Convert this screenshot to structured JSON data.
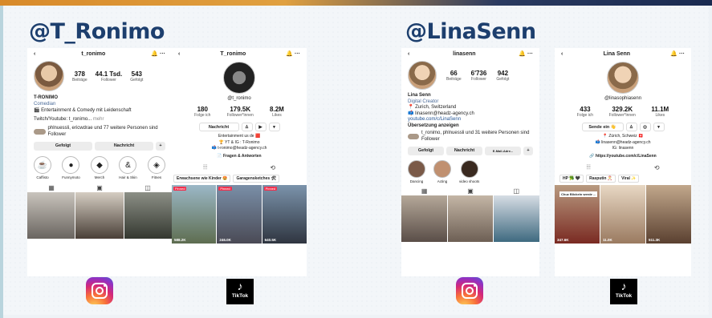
{
  "handles": {
    "left": "@T_Ronimo",
    "right": "@LinaSenn"
  },
  "ronimo_ig": {
    "username": "t_ronimo",
    "posts": "378",
    "posts_label": "Beiträge",
    "followers": "44.1 Tsd.",
    "followers_label": "Follower",
    "following": "543",
    "following_label": "Gefolgt",
    "name": "T-RONIMO",
    "category": "Comedian",
    "bio": "🎬 Entertainment & Comedy mit Leidenschaft",
    "bio2": "Twitch/Youtube: t_ronimo...",
    "more": "mehr",
    "followed_by": "phlnuessli, ericwdrae und 77 weitere Personen sind Follower",
    "btn_follow": "Gefolgt",
    "btn_message": "Nachricht",
    "highlights": [
      "Caffisto",
      "Funnymoto",
      "Merch",
      "Hair & Skin",
      "Fitnes"
    ]
  },
  "ronimo_tt": {
    "username": "T_ronimo",
    "handle": "@t_ronimo",
    "following": "180",
    "following_label": "Folge ich",
    "followers": "179.5K",
    "followers_label": "Follower*innen",
    "likes": "8.2M",
    "likes_label": "Likes",
    "btn_message": "Nachricht",
    "bio1": "Entertainment us de 🟥",
    "bio2": "🏆 YT & IG : T-Ronimo",
    "bio3": "📫 t-ronimo@headz-agency.ch",
    "qa": "📄 Fragen & Antworten",
    "playlist1": "Erwachsene wie Kinder 🤩",
    "playlist2": "Garagensketches 🛠",
    "pinned": "Pinned",
    "views": [
      "588.2K",
      "246.0K",
      "640.5K"
    ]
  },
  "lina_ig": {
    "username": "linasenn",
    "posts": "66",
    "posts_label": "Beiträge",
    "followers": "6'736",
    "followers_label": "Follower",
    "following": "942",
    "following_label": "Gefolgt",
    "name": "Lina Senn",
    "category": "Digital Creator",
    "loc": "📍 Zurich, Switzerland",
    "mail": "📫 linasenn@headz-agency.ch",
    "yt": "youtube.com/c/LinaSenn",
    "translate": "Übersetzung anzeigen",
    "followed_by": "t_ronimo, phlnuessli und 31 weitere Personen sind Follower",
    "btn_follow": "Gefolgt",
    "btn_message": "Nachricht",
    "btn_email": "E-Mail-Adre...",
    "highlights": [
      "Dancing",
      "Acting",
      "video shoots"
    ]
  },
  "lina_tt": {
    "username": "Lina Senn",
    "handle": "@linasophiasenn",
    "following": "433",
    "following_label": "Folge ich",
    "followers": "329.2K",
    "followers_label": "Follower*innen",
    "likes": "11.1M",
    "likes_label": "Likes",
    "btn_message": "Sende ein 👋",
    "bio1": "📍 Zürich, Schweiz 🇨🇭",
    "bio2": "📫 linasenn@headz-agency.ch",
    "bio3": "IG: linasenn",
    "link": "🔗 https://youtube.com/c/LinaSenn",
    "playlist1": "HP 🥦 🖤",
    "playlist2": "Rasputin 🎅",
    "playlist3": "Viral ✨",
    "caption": "Chuz Blickeln werde ...",
    "views": [
      "347.6K",
      "11.0K",
      "511.3K"
    ]
  },
  "logos": {
    "tiktok": "TikTok"
  }
}
